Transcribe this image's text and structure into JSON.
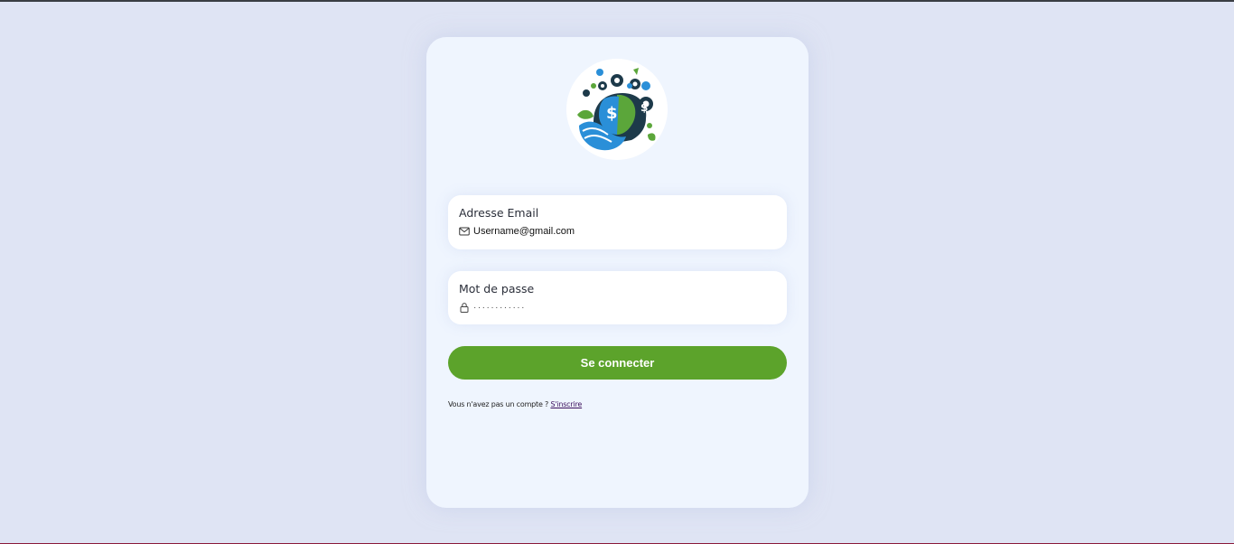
{
  "login": {
    "email_label": "Adresse Email",
    "email_value": "Username@gmail.com",
    "email_icon": "mail-icon",
    "password_label": "Mot de passe",
    "password_value": "············",
    "password_icon": "lock-icon",
    "submit_label": "Se connecter",
    "signup_prompt": "Vous n'avez pas un compte ?",
    "signup_link": "S'inscrire"
  },
  "colors": {
    "background": "#dfe4f4",
    "card": "#eff5fe",
    "primary_button": "#5ca32b",
    "link": "#3b0e5b"
  },
  "logo_icon": "finance-ecology-gears-logo"
}
